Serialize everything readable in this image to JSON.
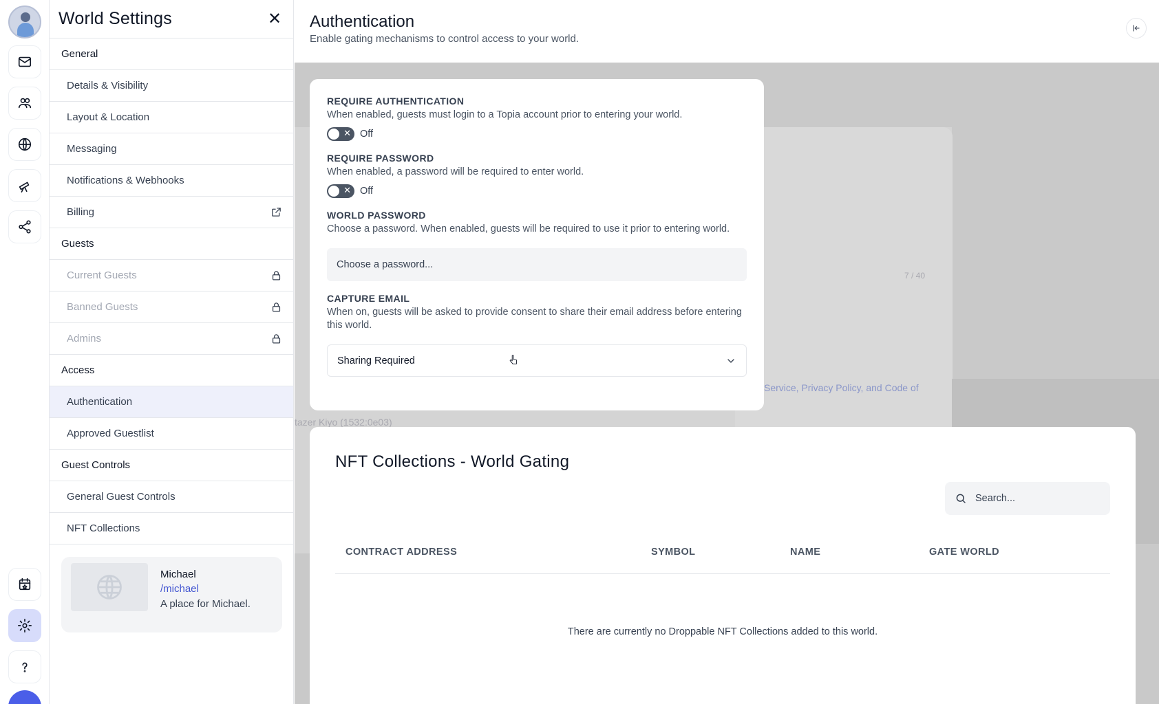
{
  "sidebar": {
    "title": "World Settings",
    "sections": [
      {
        "label": "General"
      },
      {
        "label": "Guests"
      },
      {
        "label": "Access"
      },
      {
        "label": "Guest Controls"
      }
    ],
    "items": [
      {
        "label": "Details & Visibility"
      },
      {
        "label": "Layout & Location"
      },
      {
        "label": "Messaging"
      },
      {
        "label": "Notifications & Webhooks"
      },
      {
        "label": "Billing"
      },
      {
        "label": "Current Guests"
      },
      {
        "label": "Banned Guests"
      },
      {
        "label": "Admins"
      },
      {
        "label": "Authentication"
      },
      {
        "label": "Approved Guestlist"
      },
      {
        "label": "General Guest Controls"
      },
      {
        "label": "NFT Collections"
      }
    ],
    "world_card": {
      "name": "Michael",
      "slug": "/michael",
      "description": "A place for Michael."
    }
  },
  "header": {
    "title": "Authentication",
    "subtitle": "Enable gating mechanisms to control access to your world."
  },
  "auth": {
    "require_auth": {
      "label": "REQUIRE AUTHENTICATION",
      "description": "When enabled, guests must login to a Topia account prior to entering your world.",
      "state": "Off"
    },
    "require_password": {
      "label": "REQUIRE PASSWORD",
      "description": "When enabled, a password will be required to enter world.",
      "state": "Off"
    },
    "world_password": {
      "label": "WORLD PASSWORD",
      "description": "Choose a password. When enabled, guests will be required to use it prior to entering world.",
      "placeholder": "Choose a password..."
    },
    "capture_email": {
      "label": "CAPTURE EMAIL",
      "description": "When on, guests will be asked to provide consent to share their email address before entering this world.",
      "selected": "Sharing Required"
    }
  },
  "nft": {
    "title": "NFT Collections - World Gating",
    "search_placeholder": "Search...",
    "columns": [
      "CONTRACT ADDRESS",
      "SYMBOL",
      "NAME",
      "GATE WORLD"
    ],
    "empty_message": "There are currently no Droppable NFT Collections added to this world."
  },
  "background": {
    "counter": "7 / 40",
    "terms_link": "Service, Privacy Policy, and Code of",
    "device": "tazer Kiyo (1532:0e03)"
  },
  "colors": {
    "accent": "#4b5ee8",
    "active_bg": "#eef0fb",
    "link": "#4356d1"
  }
}
